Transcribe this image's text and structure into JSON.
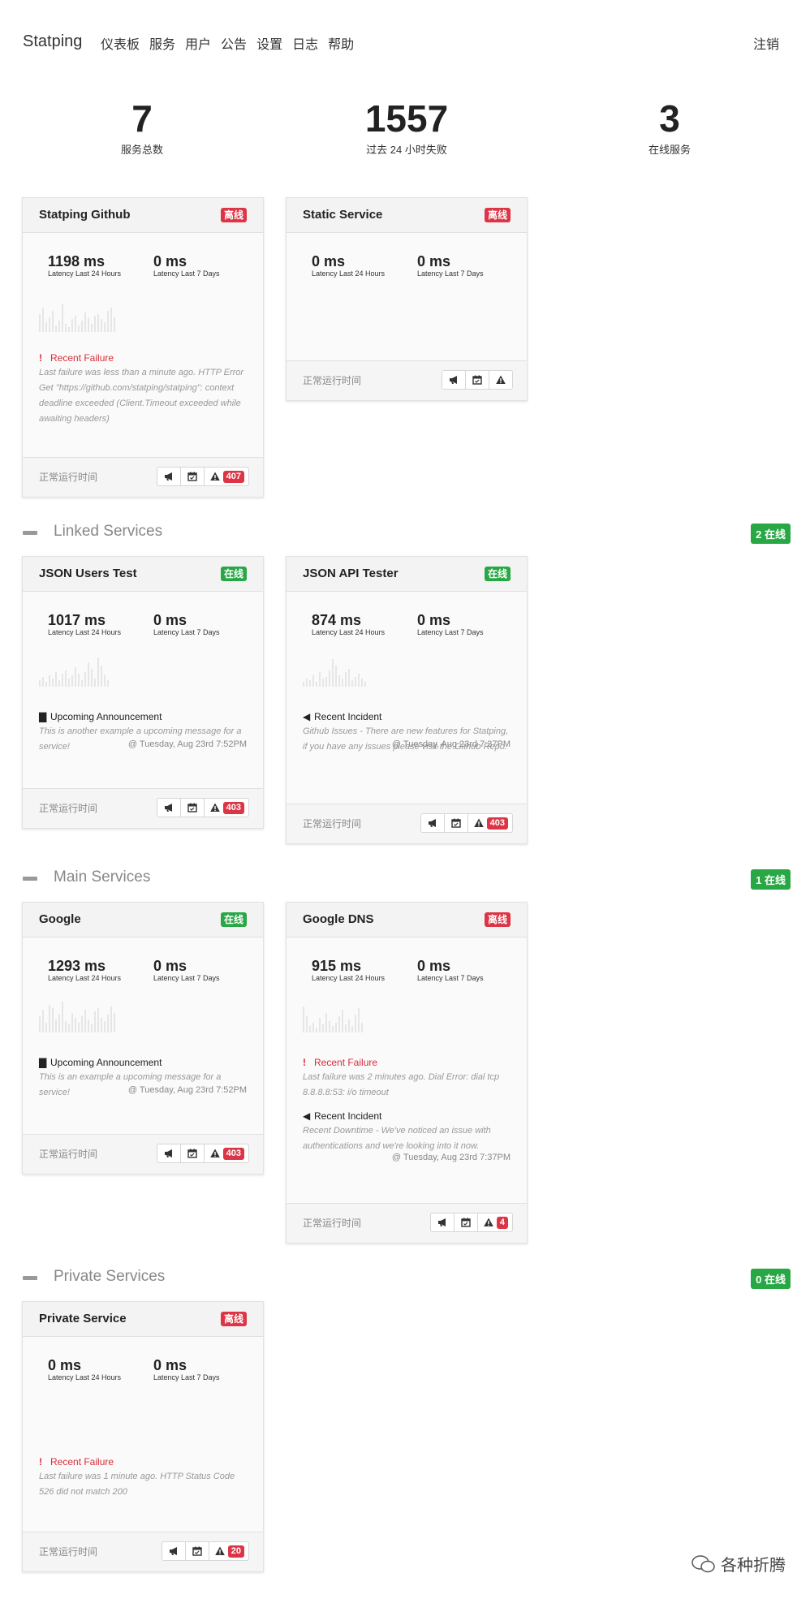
{
  "nav": {
    "brand": "Statping",
    "links": [
      "仪表板",
      "服务",
      "用户",
      "公告",
      "设置",
      "日志",
      "帮助"
    ],
    "logout": "注销"
  },
  "stats": [
    {
      "value": "7",
      "label": "服务总数"
    },
    {
      "value": "1557",
      "label": "过去 24 小时失败"
    },
    {
      "value": "3",
      "label": "在线服务"
    }
  ],
  "common": {
    "uptime_label": "正常运行时间",
    "latency_24h_label": "Latency Last 24 Hours",
    "latency_7d_label": "Latency Last 7 Days",
    "status_offline": "离线",
    "status_online": "在线"
  },
  "sections": [
    {
      "title": "Linked Services",
      "online": "2 在线"
    },
    {
      "title": "Main Services",
      "online": "1 在线"
    },
    {
      "title": "Private Services",
      "online": "0 在线"
    }
  ],
  "cards": [
    {
      "name": "Statping Github",
      "status": "离线",
      "lat24": "1198 ms",
      "lat7": "0 ms",
      "messages": [
        {
          "type": "failure",
          "title": "Recent Failure",
          "body": "Last failure was less than a minute ago. HTTP Error Get \"https://github.com/statping/statping\": context deadline exceeded (Client.Timeout exceeded while awaiting headers)"
        }
      ],
      "count": "407"
    },
    {
      "name": "Static Service",
      "status": "离线",
      "lat24": "0 ms",
      "lat7": "0 ms",
      "messages": [],
      "count": ""
    },
    {
      "name": "JSON Users Test",
      "status": "在线",
      "lat24": "1017 ms",
      "lat7": "0 ms",
      "messages": [
        {
          "type": "announcement",
          "title": "Upcoming Announcement",
          "body": "This is another example a upcoming message for a service!",
          "time": "@ Tuesday, Aug 23rd 7:52PM"
        }
      ],
      "count": "403"
    },
    {
      "name": "JSON API Tester",
      "status": "在线",
      "lat24": "874 ms",
      "lat7": "0 ms",
      "messages": [
        {
          "type": "incident",
          "title": "Recent Incident",
          "body": "Github Issues - There are new features for Statping, if you have any issues please visit the Github Repo.",
          "time": "@ Tuesday, Aug 23rd 7:37PM"
        }
      ],
      "count": "403"
    },
    {
      "name": "Google",
      "status": "在线",
      "lat24": "1293 ms",
      "lat7": "0 ms",
      "messages": [
        {
          "type": "announcement",
          "title": "Upcoming Announcement",
          "body": "This is an example a upcoming message for a service!",
          "time": "@ Tuesday, Aug 23rd 7:52PM"
        }
      ],
      "count": "403"
    },
    {
      "name": "Google DNS",
      "status": "离线",
      "lat24": "915 ms",
      "lat7": "0 ms",
      "messages": [
        {
          "type": "failure",
          "title": "Recent Failure",
          "body": "Last failure was 2 minutes ago. Dial Error: dial tcp 8.8.8.8:53: i/o timeout"
        },
        {
          "type": "incident",
          "title": "Recent Incident",
          "body": "Recent Downtime - We've noticed an issue with authentications and we're looking into it now.",
          "time": "@ Tuesday, Aug 23rd 7:37PM"
        }
      ],
      "count": "4"
    },
    {
      "name": "Private Service",
      "status": "离线",
      "lat24": "0 ms",
      "lat7": "0 ms",
      "messages": [
        {
          "type": "failure",
          "title": "Recent Failure",
          "body": "Last failure was 1 minute ago. HTTP Status Code 526 did not match 200"
        }
      ],
      "count": "20"
    }
  ],
  "watermark": "各种折腾"
}
